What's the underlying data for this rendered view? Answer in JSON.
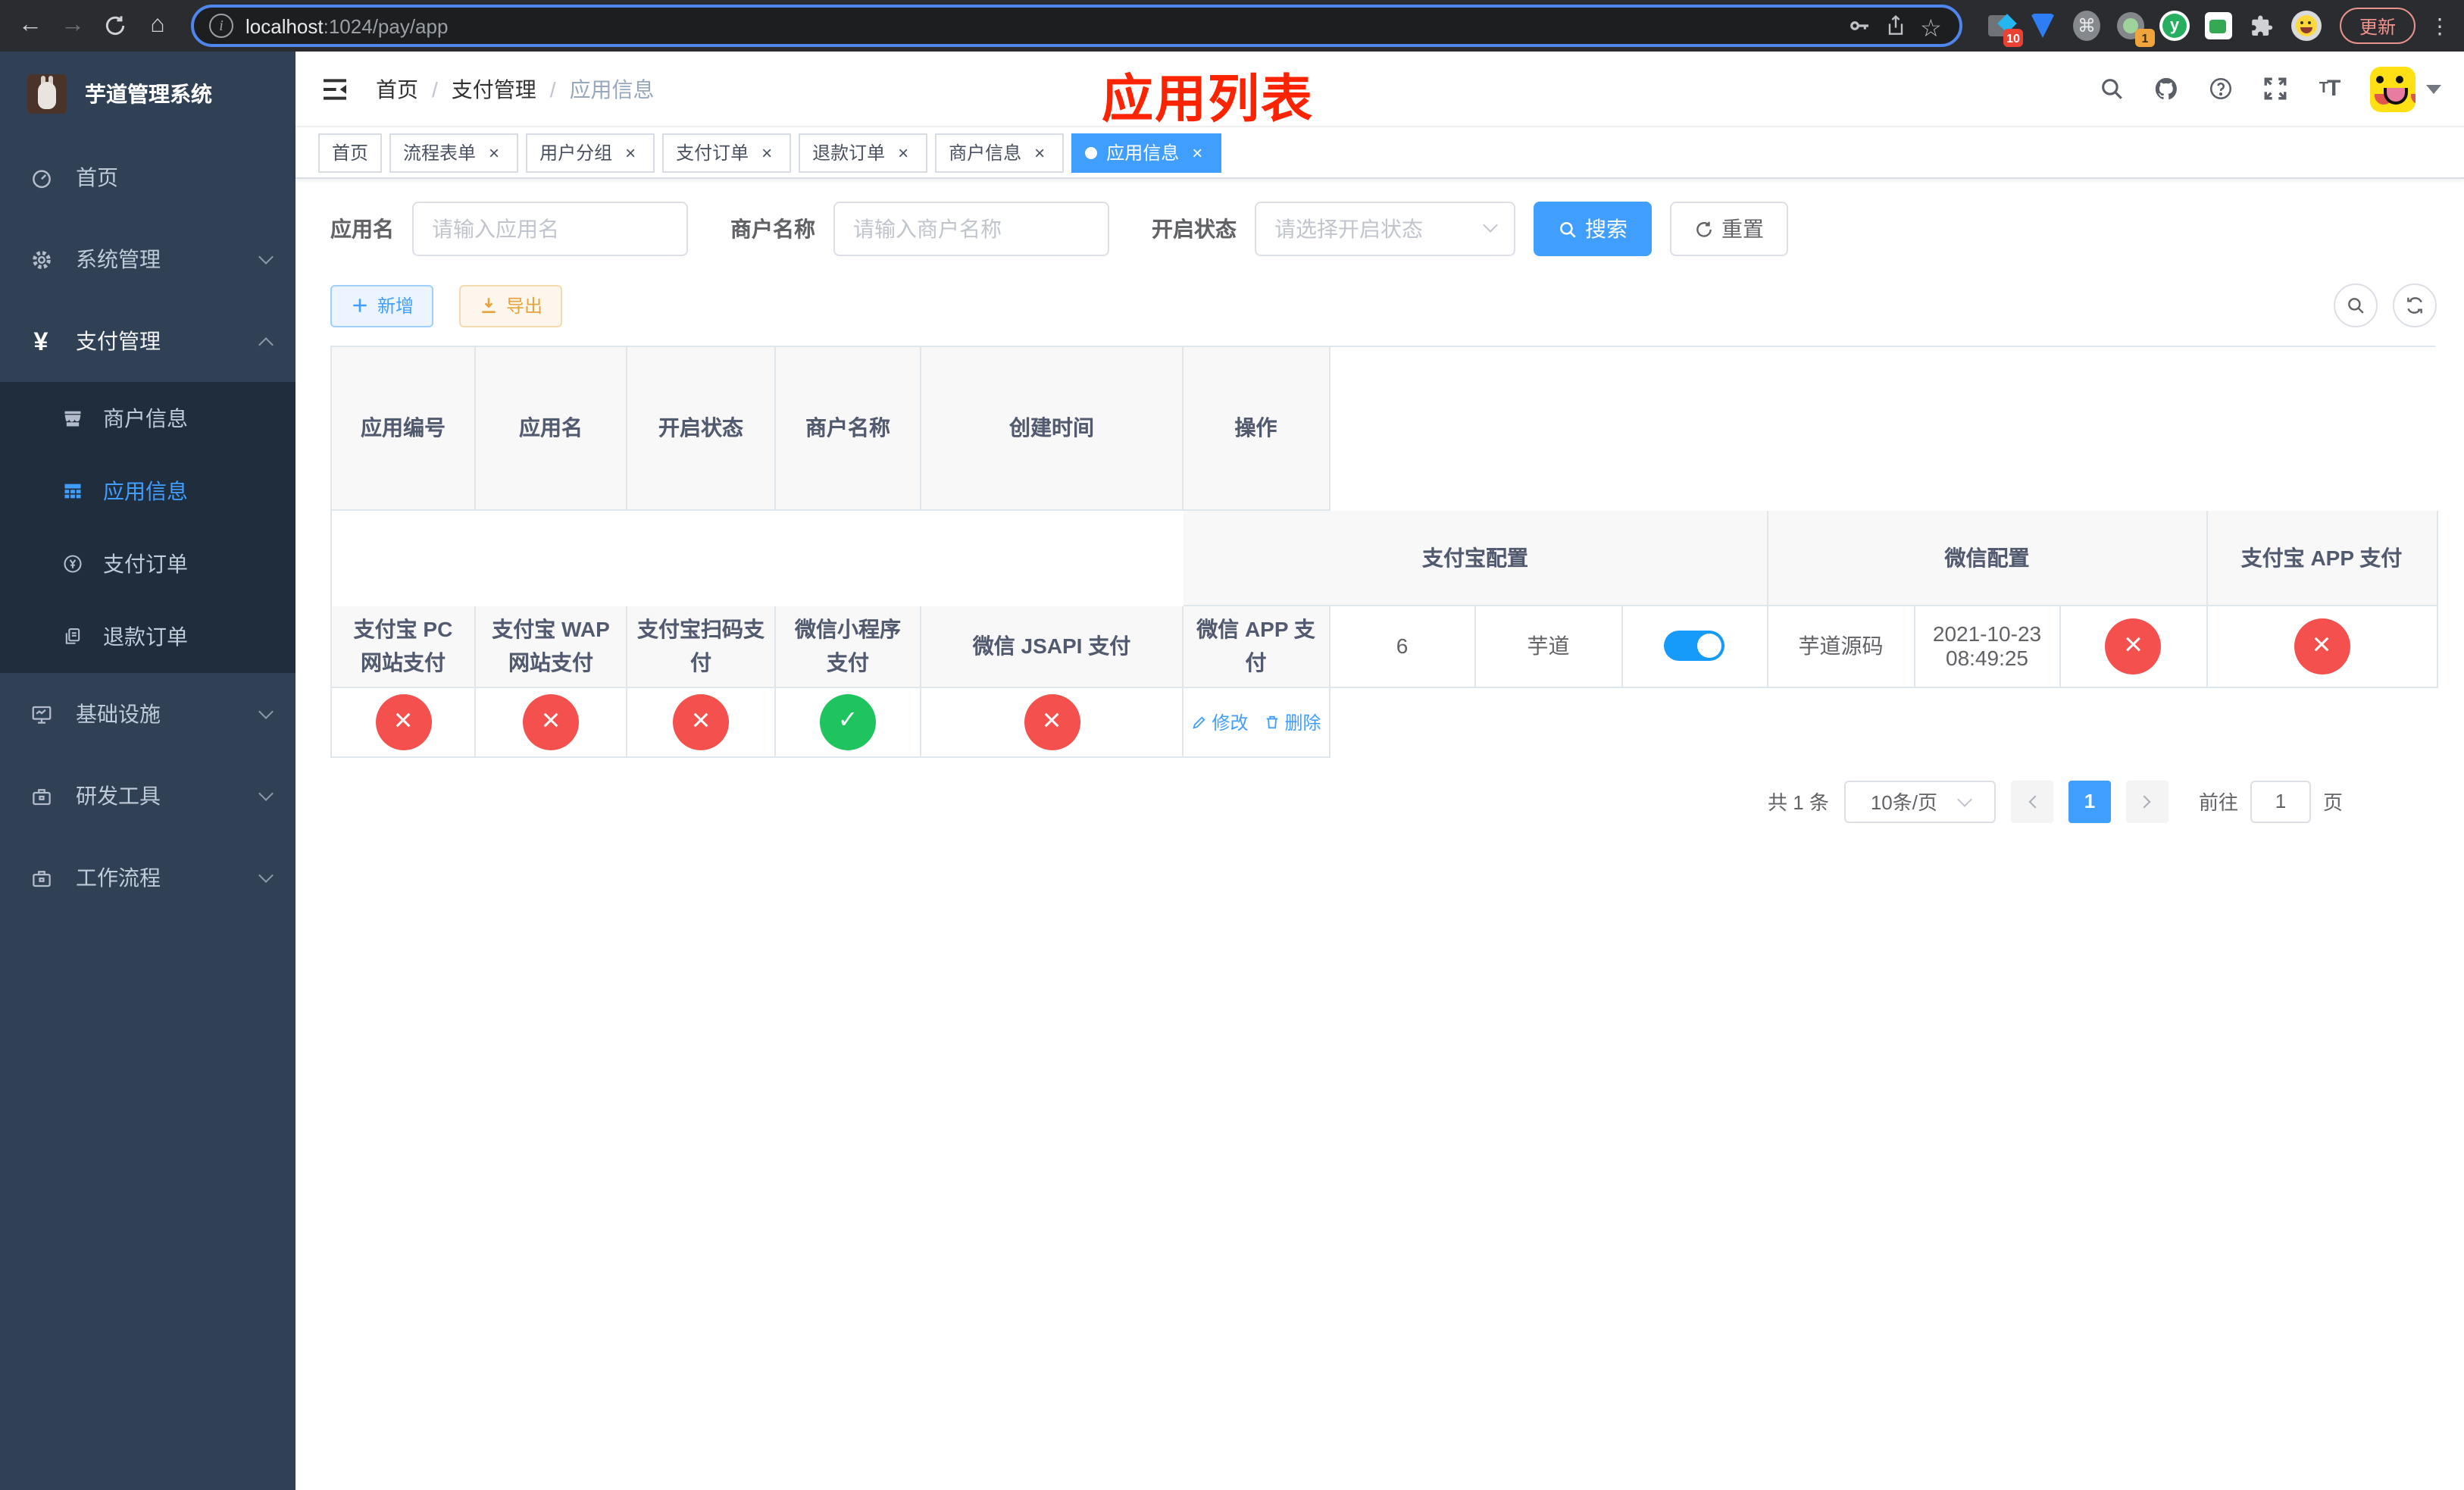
{
  "browser": {
    "url_host": "localhost",
    "url_path": ":1024/pay/app",
    "update_button": "更新",
    "ext_badge_blue_grid": "10",
    "ext_badge_camera": "1",
    "ext_y_letter": "y"
  },
  "sidebar": {
    "title": "芋道管理系统",
    "items": [
      {
        "label": "首页"
      },
      {
        "label": "系统管理"
      },
      {
        "label": "支付管理"
      },
      {
        "label": "商户信息"
      },
      {
        "label": "应用信息"
      },
      {
        "label": "支付订单"
      },
      {
        "label": "退款订单"
      },
      {
        "label": "基础设施"
      },
      {
        "label": "研发工具"
      },
      {
        "label": "工作流程"
      }
    ]
  },
  "header": {
    "breadcrumb": {
      "home": "首页",
      "parent": "支付管理",
      "current": "应用信息",
      "separator": "/"
    },
    "annotation": "应用列表"
  },
  "tabs": [
    {
      "label": "首页"
    },
    {
      "label": "流程表单"
    },
    {
      "label": "用户分组"
    },
    {
      "label": "支付订单"
    },
    {
      "label": "退款订单"
    },
    {
      "label": "商户信息"
    },
    {
      "label": "应用信息"
    }
  ],
  "search": {
    "app_name_label": "应用名",
    "app_name_placeholder": "请输入应用名",
    "merchant_label": "商户名称",
    "merchant_placeholder": "请输入商户名称",
    "status_label": "开启状态",
    "status_placeholder": "请选择开启状态",
    "search_button": "搜索",
    "reset_button": "重置"
  },
  "toolbar": {
    "add_label": "新增",
    "export_label": "导出"
  },
  "table": {
    "columns": {
      "app_id": "应用编号",
      "app_name": "应用名",
      "status": "开启状态",
      "merchant": "商户名称",
      "created": "创建时间",
      "alipay_group": "支付宝配置",
      "alipay_app": "支付宝 APP 支付",
      "alipay_pc": "支付宝 PC 网站支付",
      "alipay_wap": "支付宝 WAP 网站支付",
      "alipay_qr": "支付宝扫码支付",
      "wechat_group": "微信配置",
      "wechat_mini": "微信小程序支付",
      "wechat_jsapi": "微信 JSAPI 支付",
      "wechat_app": "微信 APP 支付",
      "actions": "操作"
    },
    "row": {
      "id": "6",
      "name": "芋道",
      "enabled": true,
      "merchant": "芋道源码",
      "created": "2021-10-23 08:49:25",
      "configs": [
        false,
        false,
        false,
        false,
        false,
        true,
        false
      ],
      "edit_label": "修改",
      "delete_label": "删除"
    }
  },
  "pagination": {
    "total": "共 1 条",
    "page_size": "10条/页",
    "current_page": "1",
    "goto_label": "前往",
    "goto_value": "1",
    "goto_suffix": "页"
  }
}
